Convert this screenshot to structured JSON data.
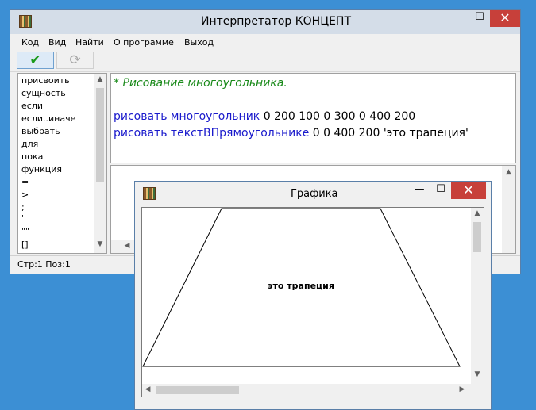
{
  "main_window": {
    "title": "Интерпретатор КОНЦЕПТ",
    "controls": {
      "minimize": "—",
      "maximize": "☐",
      "close": "✕"
    },
    "menu": [
      "Код",
      "Вид",
      "Найти",
      "О программе",
      "Выход"
    ],
    "toolbar": {
      "run_icon": "checkmark-icon",
      "reload_icon": "refresh-icon",
      "run_glyph": "✔",
      "reload_glyph": "⟳"
    },
    "keywords": [
      "присвоить",
      "сущность",
      "если",
      "если..иначе",
      "выбрать",
      "для",
      "пока",
      "функция",
      "=",
      ">",
      ";",
      "''",
      "\"\"",
      "[]"
    ],
    "code": {
      "comment": "* Рисование многоугольника.",
      "line1_cmd": "рисовать многоугольник",
      "line1_args": " 0 200 100 0 300 0 400 200",
      "line2_cmd": "рисовать текстВПрямоугольнике",
      "line2_args": " 0 0 400 200 'это трапеция'"
    },
    "status": "Стр:1 Поз:1"
  },
  "graphics_window": {
    "title": "Графика",
    "controls": {
      "minimize": "—",
      "maximize": "☐",
      "close": "✕"
    },
    "caption_text": "это трапеция"
  },
  "colors": {
    "desktop": "#3c8fd4",
    "comment": "#1a8a1a",
    "keyword": "#1a1acc",
    "close": "#c7403a"
  }
}
